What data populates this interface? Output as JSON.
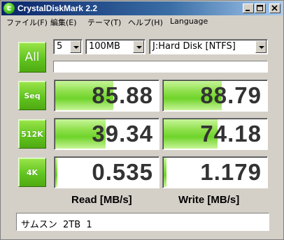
{
  "window": {
    "title": "CrystalDiskMark 2.2",
    "app_icon_letter": "c"
  },
  "menu": {
    "items": [
      "ファイル(F)",
      "編集(E)",
      "テーマ(T)",
      "ヘルプ(H)",
      "Language"
    ]
  },
  "controls": {
    "all_label": "All",
    "count_value": "5",
    "size_value": "100MB",
    "drive_value": "J:Hard Disk [NTFS]",
    "progress": 0
  },
  "tests": [
    {
      "label": "Seq",
      "read": "85.88",
      "write": "88.79",
      "read_fill": 0.56,
      "write_fill": 0.56
    },
    {
      "label": "512K",
      "read": "39.34",
      "write": "74.18",
      "read_fill": 0.48,
      "write_fill": 0.52
    },
    {
      "label": "4K",
      "read": "0.535",
      "write": "1.179",
      "read_fill": 0.02,
      "write_fill": 0.03
    }
  ],
  "columns": {
    "read_label": "Read [MB/s]",
    "write_label": "Write [MB/s]"
  },
  "comment": "サムスン  2TB  1",
  "colors": {
    "accent_green": "#62c520",
    "title_blue": "#0a246a"
  },
  "icons": [
    "minimize-icon",
    "maximize-icon",
    "close-icon",
    "dropdown-arrow-icon"
  ]
}
